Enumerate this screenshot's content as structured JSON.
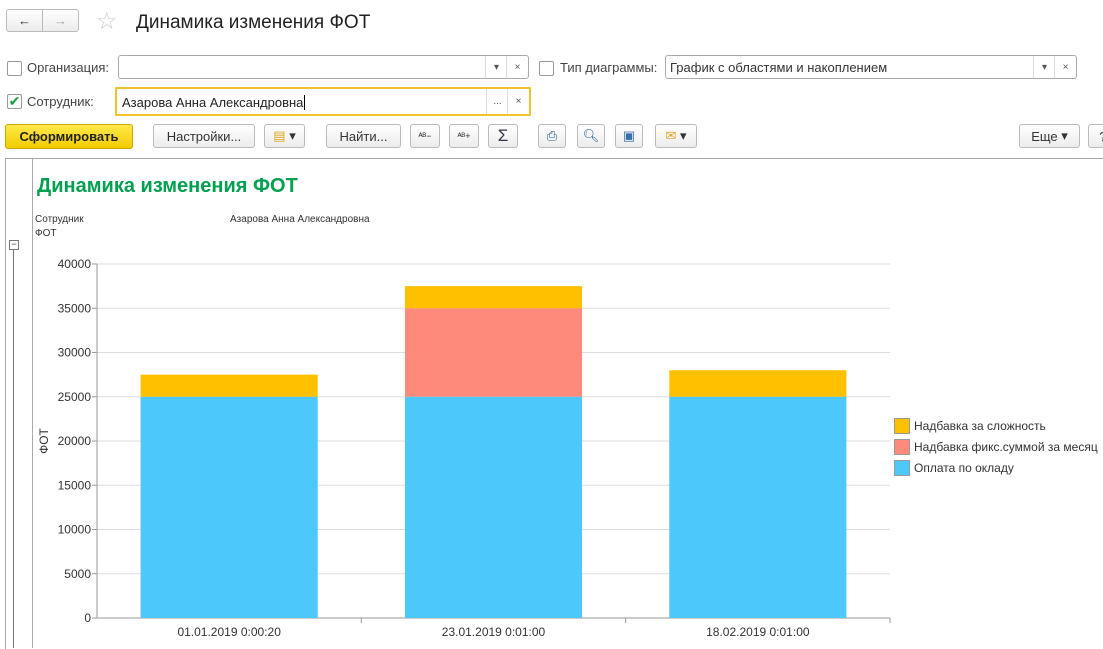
{
  "window": {
    "title": "Динамика изменения ФОТ"
  },
  "filters": {
    "organization": {
      "label": "Организация:",
      "value": "",
      "checked": false
    },
    "chart_type": {
      "label": "Тип диаграммы:",
      "value": "График с областями и накоплением",
      "checked": false
    },
    "employee": {
      "label": "Сотрудник:",
      "value": "Азарова Анна Александровна",
      "checked": true
    }
  },
  "toolbar": {
    "generate": "Сформировать",
    "settings": "Настройки...",
    "find": "Найти...",
    "sum": "Σ",
    "more": "Еще",
    "ellipsis": "...",
    "clear": "×"
  },
  "report": {
    "title": "Динамика изменения ФОТ",
    "param_label": "Сотрудник",
    "param_value": "Азарова Анна Александровна",
    "measure_label": "ФОТ"
  },
  "colors": {
    "accent": "#f5d000",
    "title_green": "#00a050"
  },
  "chart_data": {
    "type": "bar",
    "stacked": true,
    "ylabel": "ФОТ",
    "ylim": [
      0,
      40000
    ],
    "yticks": [
      "0",
      "5000",
      "10000",
      "15000",
      "20000",
      "25000",
      "30000",
      "35000",
      "40000"
    ],
    "categories": [
      "01.01.2019 0:00:20",
      "23.01.2019 0:01:00",
      "18.02.2019 0:01:00"
    ],
    "series": [
      {
        "name": "Оплата по окладу",
        "color": "#4dc8fb",
        "values": [
          25000,
          25000,
          25000
        ]
      },
      {
        "name": "Надбавка фикс.суммой за месяц",
        "color": "#fd8a7a",
        "values": [
          0,
          10000,
          0
        ]
      },
      {
        "name": "Надбавка за сложность",
        "color": "#ffc000",
        "values": [
          2500,
          2500,
          3000
        ]
      }
    ],
    "legend_order": [
      2,
      1,
      0
    ],
    "legend": "right"
  }
}
